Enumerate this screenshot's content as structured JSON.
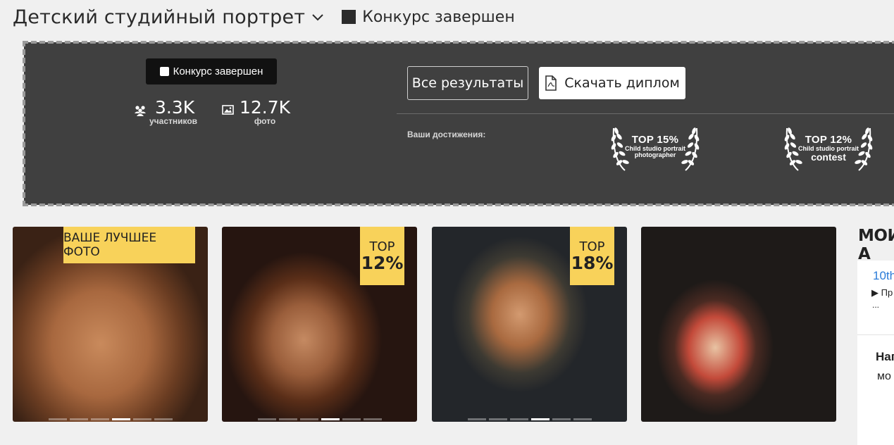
{
  "header": {
    "title": "Детский студийный портрет",
    "status": "Конкурс завершен"
  },
  "panel": {
    "badge": "Конкурс завершен",
    "stats": [
      {
        "value": "3.3K",
        "label": "участников",
        "icon": "users-icon"
      },
      {
        "value": "12.7K",
        "label": "фото",
        "icon": "image-icon"
      }
    ],
    "buttons": {
      "all_results": "Все результаты",
      "download": "Скачать диплом"
    },
    "achievements_label": "Ваши достижения:",
    "achievements": [
      {
        "top": "TOP 15%",
        "line1": "Child studio portrait",
        "line2": "photographer"
      },
      {
        "top": "TOP 12%",
        "line1": "Child studio portrait",
        "line2": "contest"
      }
    ]
  },
  "photos": [
    {
      "ribbon": "ВАШЕ ЛУЧШЕЕ ФОТО",
      "active_dot": 3
    },
    {
      "ribbon_top": "TOP",
      "ribbon_pct": "12%",
      "active_dot": 3
    },
    {
      "ribbon_top": "TOP",
      "ribbon_pct": "18%",
      "active_dot": 3
    },
    {}
  ],
  "sidebar": {
    "title": "МОИ А",
    "link": "10th",
    "play_text": "▶ Пр",
    "ellipsis": "...",
    "bold_text": "Наг",
    "sub_text": "мо"
  },
  "colors": {
    "accent": "#f8d25a",
    "panel": "#404040",
    "link": "#2a7bd8"
  }
}
